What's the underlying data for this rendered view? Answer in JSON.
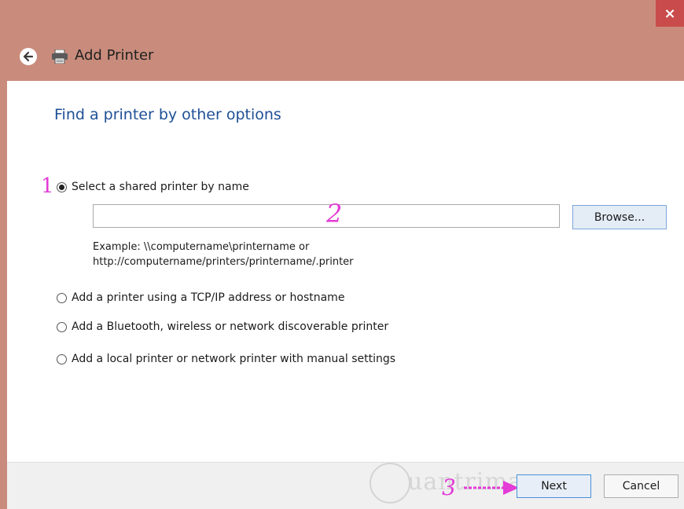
{
  "window": {
    "title": "Add Printer",
    "close_label": "×"
  },
  "main": {
    "heading": "Find a printer by other options",
    "options": [
      {
        "label": "Select a shared printer by name",
        "checked": true
      },
      {
        "label": "Add a printer using a TCP/IP address or hostname",
        "checked": false
      },
      {
        "label": "Add a Bluetooth, wireless or network discoverable printer",
        "checked": false
      },
      {
        "label": "Add a local printer or network printer with manual settings",
        "checked": false
      }
    ],
    "printer_name_value": "",
    "browse_label": "Browse...",
    "example_line1": "Example: \\\\computername\\printername or",
    "example_line2": "http://computername/printers/printername/.printer"
  },
  "annotations": {
    "step1": "1",
    "step2": "2",
    "step3": "3"
  },
  "footer": {
    "next_label": "Next",
    "cancel_label": "Cancel",
    "watermark": "uantrimang"
  },
  "colors": {
    "titlebar": "#c98c7c",
    "heading": "#1e4f96",
    "annotation": "#e33bd6",
    "close": "#c94b4b"
  },
  "icons": {
    "back": "back-arrow-icon",
    "printer": "printer-icon",
    "close": "close-icon"
  }
}
